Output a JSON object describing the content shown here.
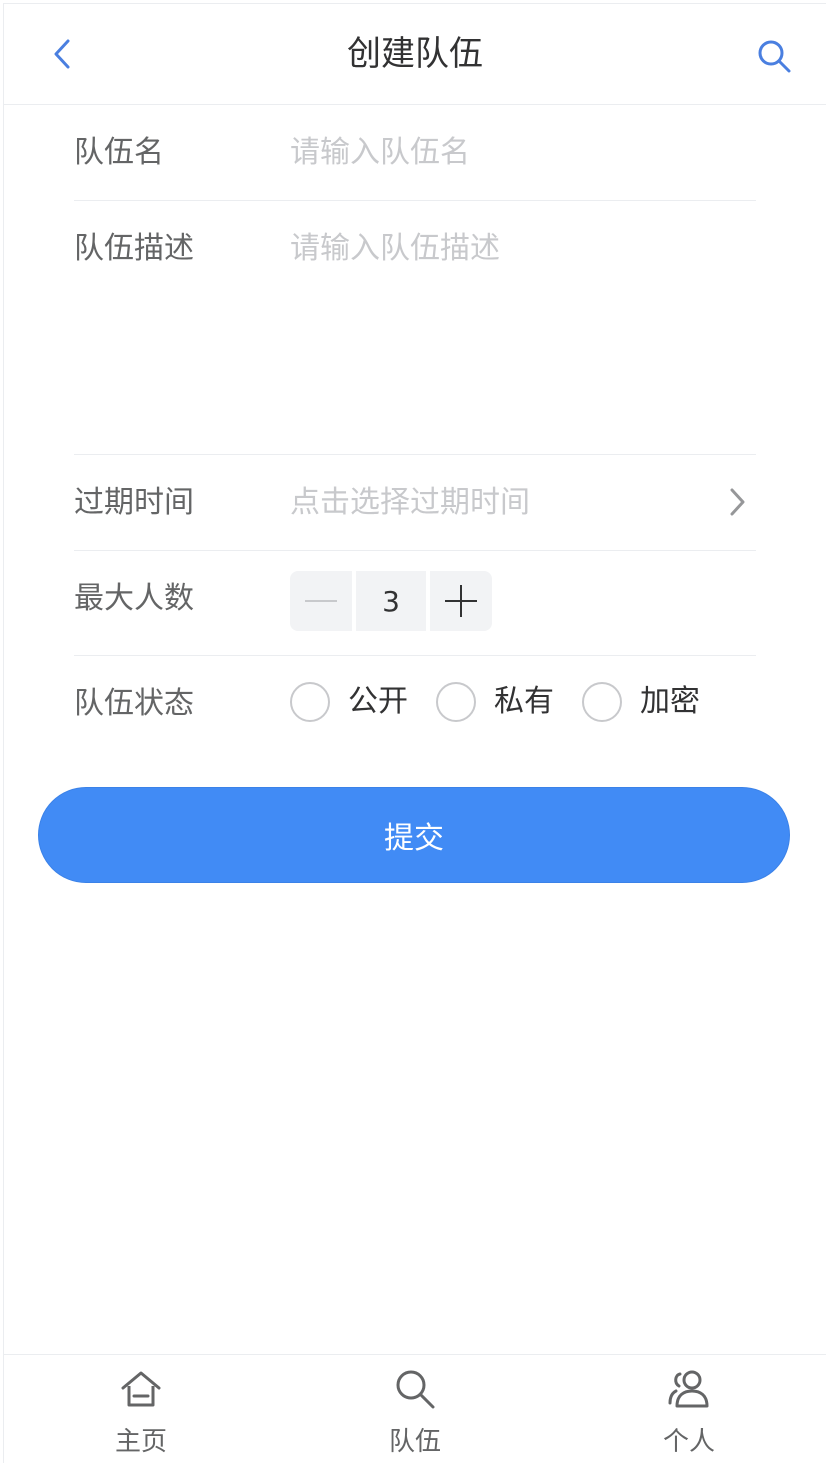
{
  "navbar": {
    "title": "创建队伍",
    "back_icon": "chevron-left-icon",
    "search_icon": "search-icon",
    "accent_color": "#4a7fe0"
  },
  "form": {
    "name": {
      "label": "队伍名",
      "placeholder": "请输入队伍名",
      "value": ""
    },
    "description": {
      "label": "队伍描述",
      "placeholder": "请输入队伍描述",
      "value": ""
    },
    "expire_time": {
      "label": "过期时间",
      "placeholder": "点击选择过期时间",
      "icon": "chevron-right-icon"
    },
    "max_members": {
      "label": "最大人数",
      "value": "3"
    },
    "status": {
      "label": "队伍状态",
      "options": [
        "公开",
        "私有",
        "加密"
      ]
    }
  },
  "submit": {
    "label": "提交",
    "color": "#418bf5"
  },
  "tabbar": {
    "items": [
      {
        "label": "主页",
        "icon": "home-icon"
      },
      {
        "label": "队伍",
        "icon": "search-icon"
      },
      {
        "label": "个人",
        "icon": "users-icon"
      }
    ]
  }
}
